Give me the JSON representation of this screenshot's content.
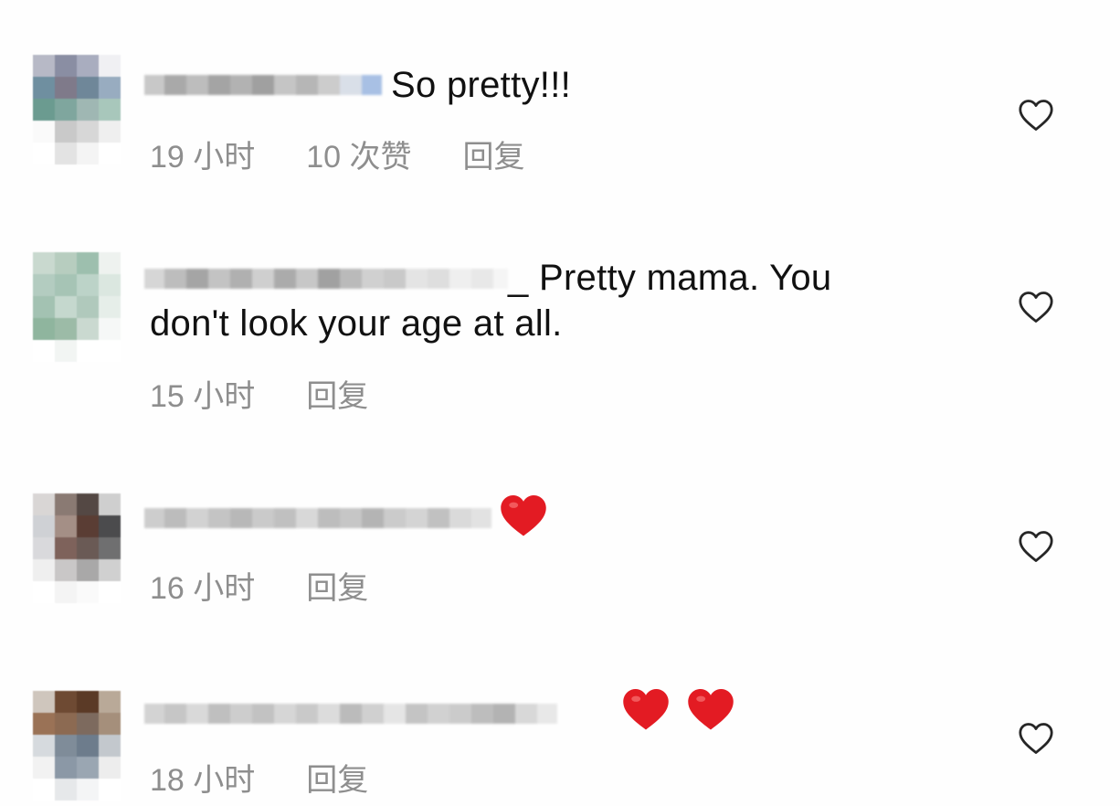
{
  "comments": [
    {
      "text": "So pretty!!!",
      "time": "19 小时",
      "likes": "10 次赞",
      "reply": "回复"
    },
    {
      "text": "_ Pretty mama. You",
      "text_line2": "don't look your age at all.",
      "time": "15 小时",
      "reply": "回复"
    },
    {
      "emoji": "red-heart",
      "emoji_count": 1,
      "time": "16 小时",
      "reply": "回复"
    },
    {
      "emoji": "red-heart",
      "emoji_count": 2,
      "time": "18 小时",
      "reply": "回复"
    }
  ],
  "colors": {
    "meta_text": "#8e8e8e",
    "comment_text": "#111111",
    "heart_red": "#e31b23",
    "heart_outline": "#262626"
  },
  "icons": {
    "like": "heart-outline-icon",
    "emoji": "red-heart-emoji"
  }
}
